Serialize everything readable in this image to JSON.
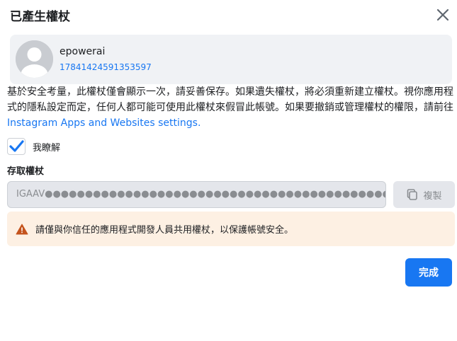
{
  "dialog": {
    "title": "已產生權杖"
  },
  "account": {
    "name": "epowerai",
    "id": "17841424591353597"
  },
  "description": {
    "text": "基於安全考量，此權杖僅會顯示一次，請妥善保存。如果遺失權杖，將必須重新建立權杖。視你應用程式的隱私設定而定，任何人都可能可使用此權杖來假冒此帳號。如果要撤銷或管理權杖的權限，請前往",
    "link_text": "Instagram Apps and Websites settings."
  },
  "acknowledge": {
    "label": "我瞭解",
    "checked": true
  },
  "token": {
    "label": "存取權杖",
    "value": "IGAAV●●●●●●●●●●●●●●●●●●●●●●●●●●●●●●●●●●●●●●●●●●●●●●●●●●●●●●●●●●●●●●●●●●●●●●"
  },
  "copy_button": {
    "label": "複製"
  },
  "warning": {
    "text": "請僅與你信任的應用程式開發人員共用權杖，以保護帳號安全。"
  },
  "done_button": {
    "label": "完成"
  },
  "colors": {
    "accent": "#1877f2",
    "warning_bg": "#fdf0e3",
    "warning_icon": "#c4531c"
  },
  "icons": {
    "close": "close-icon",
    "avatar": "default-avatar",
    "check": "check-icon",
    "copy": "copy-icon",
    "warning": "warning-icon"
  }
}
